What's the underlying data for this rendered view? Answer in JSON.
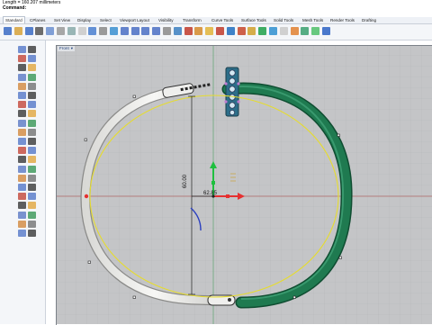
{
  "command_area": {
    "line1": "Length = 160.207 millimeters",
    "prompt": "Command:"
  },
  "tabs": [
    "Standard",
    "CPlanes",
    "Set View",
    "Display",
    "Select",
    "Viewport Layout",
    "Visibility",
    "Transform",
    "Curve Tools",
    "Surface Tools",
    "Solid Tools",
    "Mesh Tools",
    "Render Tools",
    "Drafting"
  ],
  "active_tab": "Standard",
  "viewport": {
    "name": "Front",
    "dropdown_glyph": "▾",
    "dims": {
      "vertical": "60.00",
      "horizontal": "62.85"
    }
  },
  "toolbar_icons": [
    "new-file-icon",
    "open-folder-icon",
    "save-icon",
    "print-icon",
    "import-icon",
    "cut-icon",
    "copy-icon",
    "paste-icon",
    "undo-icon",
    "pan-icon",
    "rotate-view-icon",
    "zoom-extents-icon",
    "zoom-window-icon",
    "zoom-selected-icon",
    "zoom-target-icon",
    "grid-snap-icon",
    "four-viewports-icon",
    "cplane-icon",
    "material-icon",
    "light-icon",
    "layer-icon",
    "object-properties-icon",
    "display-mode-icon",
    "render-icon",
    "material-sphere-icon",
    "environment-icon",
    "settings-gear-icon",
    "analyze-icon",
    "mesh-icon",
    "drafting-icon",
    "help-icon"
  ],
  "colors": {
    "viewport_bg": "#c4c5c7",
    "grid_line": "#b6b7b9",
    "x_axis": "#c0392b",
    "y_axis": "#27ae60",
    "selection_yellow": "#e6dc2e",
    "silver_band": "#e8e8e6",
    "green_band": "#1f7a50"
  }
}
